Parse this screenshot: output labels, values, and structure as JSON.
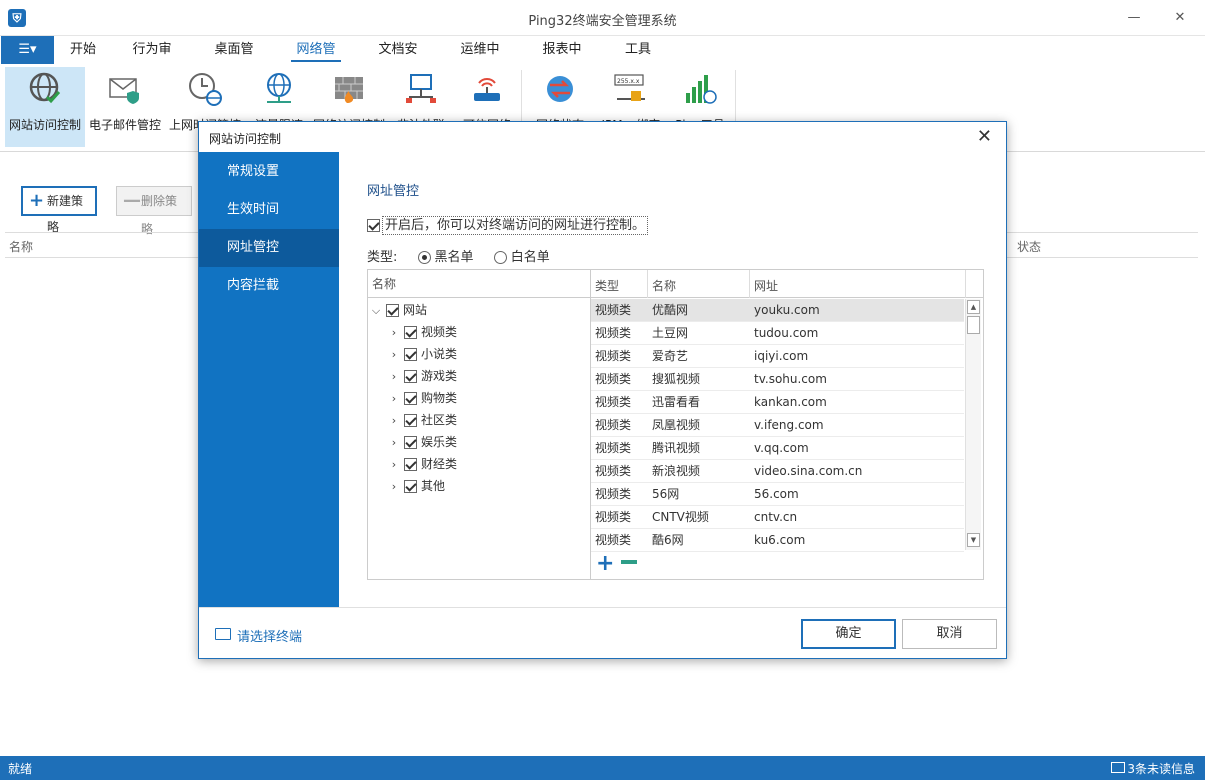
{
  "app": {
    "title": "Ping32终端安全管理系统"
  },
  "ribbon_tabs": [
    "开始",
    "行为审计",
    "桌面管理",
    "网络管理",
    "文档安全",
    "运维中心",
    "报表中心",
    "工具箱"
  ],
  "ribbon_buttons": [
    {
      "label": "网站访问控制",
      "icon": "globe-check-icon"
    },
    {
      "label": "电子邮件管控",
      "icon": "mail-shield-icon"
    },
    {
      "label": "上网时间管控",
      "icon": "clock-globe-icon"
    },
    {
      "label": "流量限速",
      "icon": "network-globe-icon"
    },
    {
      "label": "网络访问控制",
      "icon": "firewall-icon"
    },
    {
      "label": "非法外联",
      "icon": "computer-network-icon"
    },
    {
      "label": "可信网络",
      "icon": "router-icon"
    },
    {
      "label": "网络状态",
      "icon": "globe-arrows-icon"
    },
    {
      "label": "IPMac绑定",
      "icon": "ipmac-lock-icon"
    },
    {
      "label": "Ping工具",
      "icon": "bar-globe-icon"
    }
  ],
  "main": {
    "new_policy": "新建策略",
    "delete_policy": "删除策略",
    "col_name": "名称",
    "col_status": "状态"
  },
  "statusbar": {
    "left": "就绪",
    "right": "3条未读信息"
  },
  "dialog": {
    "title": "网站访问控制",
    "side_items": [
      "常规设置",
      "生效时间",
      "网址管控",
      "内容拦截"
    ],
    "section_title": "网址管控",
    "enable_text": "开启后，你可以对终端访问的网址进行控制。",
    "type_label": "类型:",
    "type_black": "黑名单",
    "type_white": "白名单",
    "tree_header": "名称",
    "tree_root": "网站",
    "tree_children": [
      "视频类",
      "小说类",
      "游戏类",
      "购物类",
      "社区类",
      "娱乐类",
      "财经类",
      "其他"
    ],
    "table_headers": [
      "类型",
      "名称",
      "网址"
    ],
    "rows": [
      [
        "视频类",
        "优酷网",
        "youku.com"
      ],
      [
        "视频类",
        "土豆网",
        "tudou.com"
      ],
      [
        "视频类",
        "爱奇艺",
        "iqiyi.com"
      ],
      [
        "视频类",
        "搜狐视频",
        "tv.sohu.com"
      ],
      [
        "视频类",
        "迅雷看看",
        "kankan.com"
      ],
      [
        "视频类",
        "凤凰视频",
        "v.ifeng.com"
      ],
      [
        "视频类",
        "腾讯视频",
        "v.qq.com"
      ],
      [
        "视频类",
        "新浪视频",
        "video.sina.com.cn"
      ],
      [
        "视频类",
        "56网",
        "56.com"
      ],
      [
        "视频类",
        "CNTV视频",
        "cntv.cn"
      ],
      [
        "视频类",
        "酷6网",
        "ku6.com"
      ]
    ],
    "pick_terminal": "请选择终端",
    "ok": "确定",
    "cancel": "取消"
  },
  "colors": {
    "accent": "#1e6fb8",
    "sidebar": "#1173c2"
  }
}
